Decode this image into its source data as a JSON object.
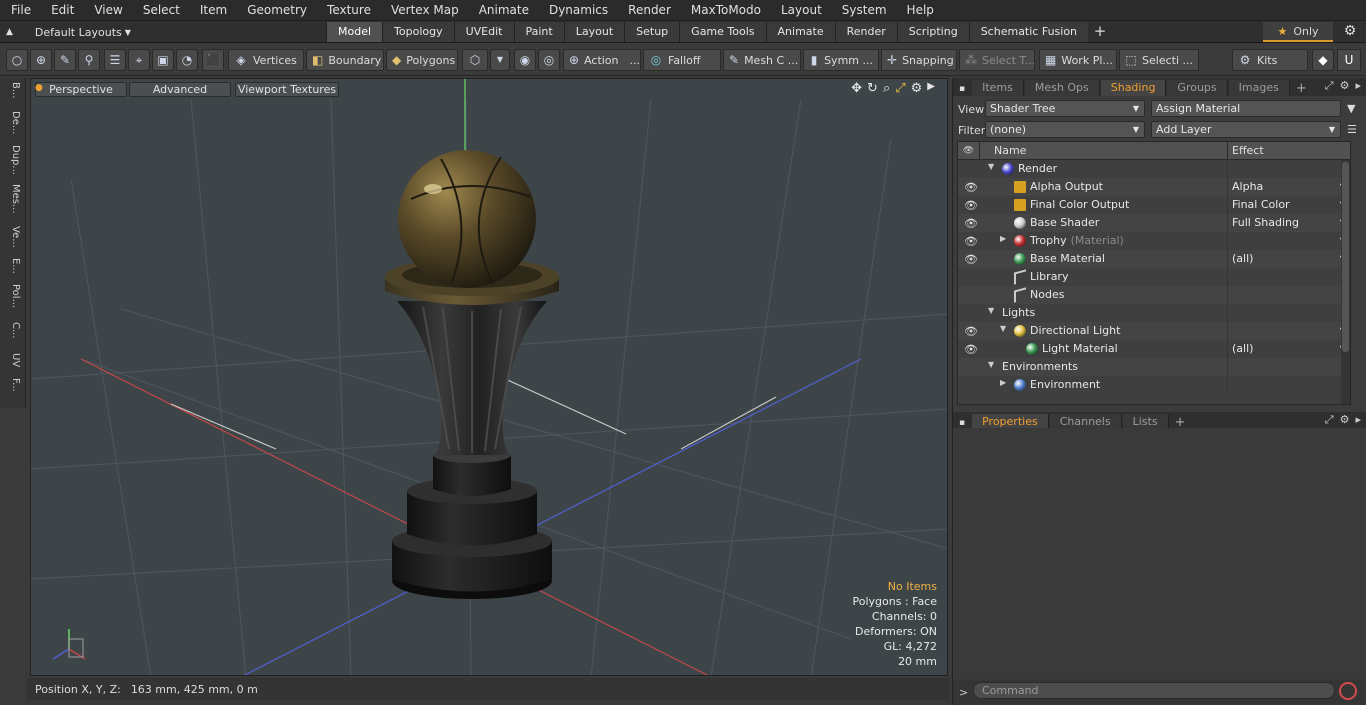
{
  "menu": [
    "File",
    "Edit",
    "View",
    "Select",
    "Item",
    "Geometry",
    "Texture",
    "Vertex Map",
    "Animate",
    "Dynamics",
    "Render",
    "MaxToModo",
    "Layout",
    "System",
    "Help"
  ],
  "layouts": {
    "selector": "Default Layouts",
    "tabs": [
      "Model",
      "Topology",
      "UVEdit",
      "Paint",
      "Layout",
      "Setup",
      "Game Tools",
      "Animate",
      "Render",
      "Scripting",
      "Schematic Fusion"
    ],
    "active_tab": "Model",
    "only_label": "Only"
  },
  "toolbar": {
    "vertices": "Vertices",
    "boundary": "Boundary",
    "polygons": "Polygons",
    "action": "Action",
    "falloff": "Falloff",
    "mesh": "Mesh C ...",
    "symm": "Symm ...",
    "snapping": "Snapping",
    "select_t": "Select T...",
    "work_pl": "Work Pl...",
    "selecti": "Selecti ...",
    "kits": "Kits"
  },
  "left_tabs": [
    "B...",
    "De...",
    "Dup...",
    "Mes...",
    "Ve...",
    "E...",
    "Pol...",
    "C...",
    "UV",
    "F..."
  ],
  "viewport": {
    "view_mode": "Perspective",
    "advanced": "Advanced",
    "textures": "Viewport Textures",
    "stats": {
      "selection": "No Items",
      "polygons": "Polygons : Face",
      "channels": "Channels: 0",
      "deformers": "Deformers: ON",
      "gl": "GL: 4,272",
      "scale": "20 mm"
    }
  },
  "status": {
    "label": "Position X, Y, Z:",
    "value": "163 mm, 425 mm, 0 m"
  },
  "panel": {
    "tabs": [
      "Items",
      "Mesh Ops",
      "Shading",
      "Groups",
      "Images"
    ],
    "active_tab": "Shading",
    "view_label": "View",
    "view_value": "Shader Tree",
    "assign": "Assign Material",
    "filter_label": "Filter",
    "filter_value": "(none)",
    "add_layer": "Add Layer",
    "col_name": "Name",
    "col_effect": "Effect",
    "tree": [
      {
        "name": "Render",
        "sub": "",
        "effect": "",
        "eye": false,
        "level": 0,
        "expand": "open",
        "icon": "render-sphere-icon",
        "color": "#4a4ad0"
      },
      {
        "name": "Alpha Output",
        "sub": "",
        "effect": "Alpha",
        "eye": true,
        "level": 1,
        "expand": "",
        "icon": "output-icon",
        "color": "#d8a020"
      },
      {
        "name": "Final Color Output",
        "sub": "",
        "effect": "Final Color",
        "eye": true,
        "level": 1,
        "expand": "",
        "icon": "output-icon",
        "color": "#d8a020"
      },
      {
        "name": "Base Shader",
        "sub": "",
        "effect": "Full Shading",
        "eye": true,
        "level": 1,
        "expand": "",
        "icon": "shader-sphere-icon",
        "color": "#d0d0d0"
      },
      {
        "name": "Trophy",
        "sub": "(Material)",
        "effect": "",
        "eye": true,
        "level": 1,
        "expand": "closed",
        "icon": "material-mask-icon",
        "color": "#c83030"
      },
      {
        "name": "Base Material",
        "sub": "",
        "effect": "(all)",
        "eye": true,
        "level": 1,
        "expand": "",
        "icon": "material-sphere-icon",
        "color": "#3a9a50"
      },
      {
        "name": "Library",
        "sub": "",
        "effect": "",
        "eye": false,
        "level": 1,
        "expand": "",
        "icon": "folder-icon",
        "color": "#cccccc"
      },
      {
        "name": "Nodes",
        "sub": "",
        "effect": "",
        "eye": false,
        "level": 1,
        "expand": "",
        "icon": "folder-icon",
        "color": "#cccccc"
      },
      {
        "name": "Lights",
        "sub": "",
        "effect": "",
        "eye": false,
        "level": 0,
        "expand": "open",
        "icon": "",
        "color": ""
      },
      {
        "name": "Directional Light",
        "sub": "",
        "effect": "",
        "eye": true,
        "level": 1,
        "expand": "open",
        "icon": "directional-light-icon",
        "color": "#e0c040"
      },
      {
        "name": "Light Material",
        "sub": "",
        "effect": "(all)",
        "eye": true,
        "level": 2,
        "expand": "",
        "icon": "material-sphere-icon",
        "color": "#3a9a50"
      },
      {
        "name": "Environments",
        "sub": "",
        "effect": "",
        "eye": false,
        "level": 0,
        "expand": "open",
        "icon": "",
        "color": ""
      },
      {
        "name": "Environment",
        "sub": "",
        "effect": "",
        "eye": false,
        "level": 1,
        "expand": "closed",
        "icon": "environment-sphere-icon",
        "color": "#5080d0"
      }
    ],
    "bottom_tabs": [
      "Properties",
      "Channels",
      "Lists"
    ],
    "bottom_active": "Properties",
    "command_placeholder": "Command",
    "prompt": ">"
  }
}
